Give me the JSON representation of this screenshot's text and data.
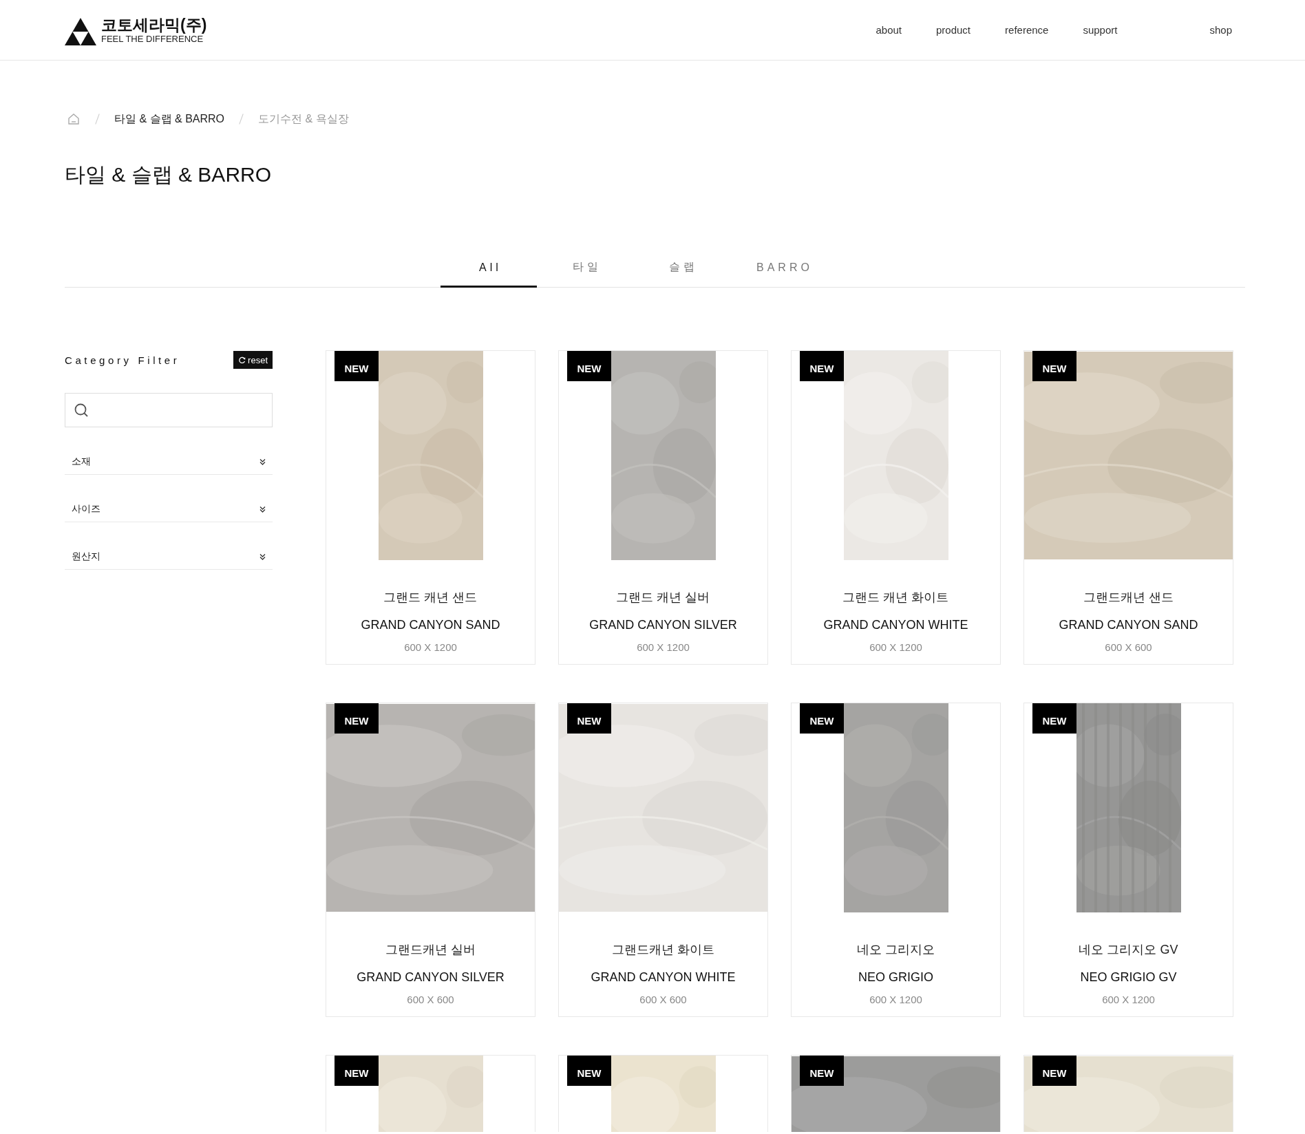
{
  "header": {
    "logo": {
      "name": "코토세라믹(주)",
      "tagline": "FEEL THE DIFFERENCE"
    },
    "nav": [
      {
        "label": "about"
      },
      {
        "label": "product"
      },
      {
        "label": "reference"
      },
      {
        "label": "support"
      },
      {
        "label": "shop",
        "kind": "external"
      }
    ]
  },
  "breadcrumb": [
    {
      "label": "타일 & 슬랩 & BARRO",
      "current": true
    },
    {
      "label": "도기수전 & 욕실장",
      "current": false
    }
  ],
  "page_title": "타일 & 슬랩 & BARRO",
  "tabs": [
    {
      "label": "All",
      "selected": true
    },
    {
      "label": "타일",
      "selected": false
    },
    {
      "label": "슬랩",
      "selected": false
    },
    {
      "label": "BARRO",
      "selected": false
    }
  ],
  "filter": {
    "title": "Category Filter",
    "reset": "reset",
    "groups": [
      {
        "label": "소재",
        "expanded": false
      },
      {
        "label": "사이즈",
        "expanded": false
      },
      {
        "label": "원산지",
        "expanded": false
      }
    ]
  },
  "products": [
    {
      "kind": "portrait",
      "badge": "NEW",
      "name_ko": "그랜드 캐년 샌드",
      "name_en": "GRAND CANYON SAND",
      "size": "600 X 1200"
    },
    {
      "kind": "portrait",
      "badge": "NEW",
      "name_ko": "그랜드 캐년 실버",
      "name_en": "GRAND CANYON SILVER",
      "size": "600 X 1200"
    },
    {
      "kind": "portrait",
      "badge": "NEW",
      "name_ko": "그랜드 캐년 화이트",
      "name_en": "GRAND CANYON WHITE",
      "size": "600 X 1200"
    },
    {
      "kind": "square",
      "badge": "NEW",
      "name_ko": "그랜드캐년 샌드",
      "name_en": "GRAND CANYON SAND",
      "size": "600 X 600"
    },
    {
      "kind": "square",
      "badge": "NEW",
      "name_ko": "그랜드캐년 실버",
      "name_en": "GRAND CANYON SILVER",
      "size": "600 X 600"
    },
    {
      "kind": "square",
      "badge": "NEW",
      "name_ko": "그랜드캐년 화이트",
      "name_en": "GRAND CANYON WHITE",
      "size": "600 X 600"
    },
    {
      "kind": "portrait",
      "badge": "NEW",
      "name_ko": "네오 그리지오",
      "name_en": "NEO GRIGIO",
      "size": "600 X 1200"
    },
    {
      "kind": "portrait",
      "badge": "NEW",
      "name_ko": "네오 그리지오 GV",
      "name_en": "NEO GRIGIO GV",
      "size": "600 X 1200"
    },
    {
      "kind": "portrait",
      "badge": "NEW"
    },
    {
      "kind": "portrait",
      "badge": "NEW"
    },
    {
      "kind": "square",
      "badge": "NEW"
    },
    {
      "kind": "square",
      "badge": "NEW"
    }
  ]
}
